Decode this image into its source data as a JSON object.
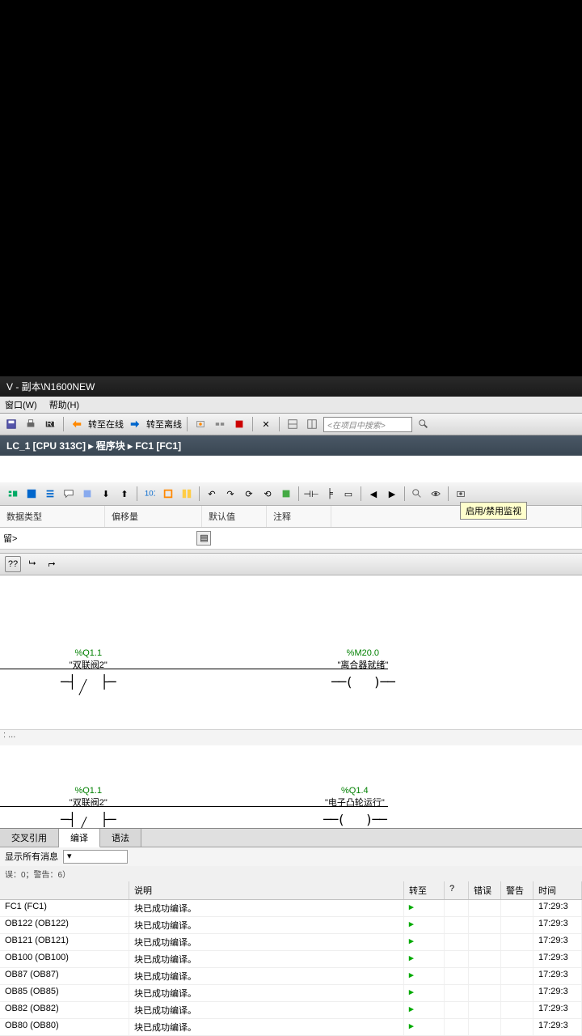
{
  "titlebar": "V - 副本\\N1600NEW",
  "menu": {
    "window": "窗口(W)",
    "help": "帮助(H)"
  },
  "toolbar1": {
    "online": "转至在线",
    "offline": "转至离线",
    "search_placeholder": "<在项目中搜索>"
  },
  "breadcrumb": "LC_1 [CPU 313C]  ▸  程序块  ▸  FC1 [FC1]",
  "tooltip": "启用/禁用监视",
  "columns": {
    "c1": "数据类型",
    "c2": "偏移量",
    "c3": "默认值",
    "c4": "注释"
  },
  "ladder": {
    "rung1": {
      "contact": {
        "addr": "%Q1.1",
        "name": "\"双联阀2\""
      },
      "coil": {
        "addr": "%M20.0",
        "name": "\"离合器就绪\""
      }
    },
    "sep": ": ...",
    "rung2": {
      "contact": {
        "addr": "%Q1.1",
        "name": "\"双联阀2\""
      },
      "coil": {
        "addr": "%Q1.4",
        "name": "\"电子凸轮运行\""
      }
    }
  },
  "bottom": {
    "tabs": {
      "t1": "交叉引用",
      "t2": "编译",
      "t3": "语法"
    },
    "filter_label": "显示所有消息",
    "status": "误：0；警告：6）",
    "headers": {
      "desc": "说明",
      "goto": "转至",
      "q": "?",
      "err": "错误",
      "warn": "警告",
      "time": "时间"
    },
    "rows": [
      {
        "path": "FC1 (FC1)",
        "desc": "块已成功编译。",
        "time": "17:29:3"
      },
      {
        "path": "OB122 (OB122)",
        "desc": "块已成功编译。",
        "time": "17:29:3"
      },
      {
        "path": "OB121 (OB121)",
        "desc": "块已成功编译。",
        "time": "17:29:3"
      },
      {
        "path": "OB100 (OB100)",
        "desc": "块已成功编译。",
        "time": "17:29:3"
      },
      {
        "path": "OB87 (OB87)",
        "desc": "块已成功编译。",
        "time": "17:29:3"
      },
      {
        "path": "OB85 (OB85)",
        "desc": "块已成功编译。",
        "time": "17:29:3"
      },
      {
        "path": "OB82 (OB82)",
        "desc": "块已成功编译。",
        "time": "17:29:3"
      },
      {
        "path": "OB80 (OB80)",
        "desc": "块已成功编译。",
        "time": "17:29:3"
      }
    ]
  }
}
